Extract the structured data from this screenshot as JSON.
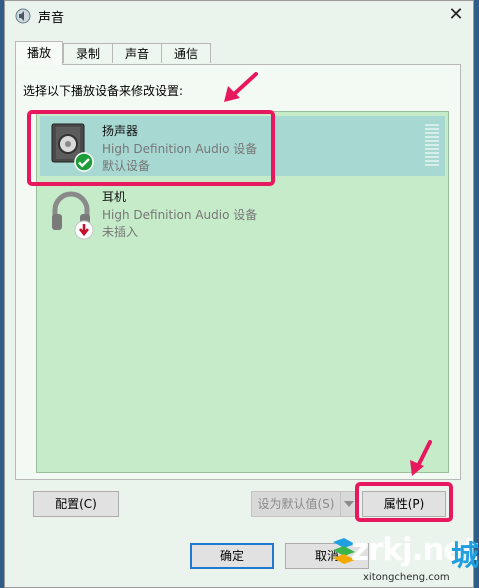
{
  "window": {
    "title": "声音",
    "close_glyph": "✕"
  },
  "tabs": [
    {
      "label": "播放",
      "active": true
    },
    {
      "label": "录制",
      "active": false
    },
    {
      "label": "声音",
      "active": false
    },
    {
      "label": "通信",
      "active": false
    }
  ],
  "instruction": "选择以下播放设备来修改设置:",
  "devices": [
    {
      "name": "扬声器",
      "driver": "High Definition Audio 设备",
      "status": "默认设备",
      "icon": "speaker-icon",
      "badge": "green-check-icon",
      "selected": true
    },
    {
      "name": "耳机",
      "driver": "High Definition Audio 设备",
      "status": "未插入",
      "icon": "headphones-icon",
      "badge": "red-down-arrow-icon",
      "selected": false
    }
  ],
  "buttons": {
    "configure": "配置(C)",
    "set_default": "设为默认值(S)",
    "properties": "属性(P)",
    "ok": "确定",
    "cancel": "取消"
  },
  "watermark": {
    "text": "zrkj.net",
    "cn": "城",
    "sub": "xitongcheng.com"
  },
  "colors": {
    "highlight": "#e8185f",
    "list_bg": "#c6ebc9",
    "selected_bg": "#a8d8d2"
  }
}
